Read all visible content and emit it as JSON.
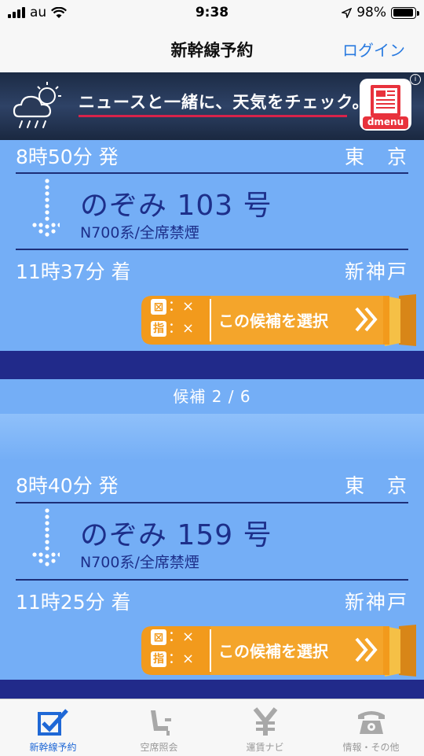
{
  "status_bar": {
    "carrier": "au",
    "time": "9:38",
    "battery": "98%",
    "battery_level": 0.98
  },
  "nav": {
    "title": "新幹線予約",
    "login": "ログイン"
  },
  "ad": {
    "text": "ニュースと一緒に、天気をチェック。",
    "brand": "dmenu",
    "info": "i"
  },
  "trains": [
    {
      "dep_time": "8時50分 発",
      "dep_station": "東　京",
      "name": "のぞみ 103 号",
      "type": "N700系/全席禁煙",
      "arr_time": "11時37分 着",
      "arr_station": "新神戸",
      "mark1": "⊠",
      "mark1_val": "：×",
      "mark2": "指",
      "mark2_val": "：×",
      "select": "この候補を選択"
    },
    {
      "dep_time": "8時40分 発",
      "dep_station": "東　京",
      "name": "のぞみ 159 号",
      "type": "N700系/全席禁煙",
      "arr_time": "11時25分 着",
      "arr_station": "新神戸",
      "mark1": "⊠",
      "mark1_val": "：×",
      "mark2": "指",
      "mark2_val": "：×",
      "select": "この候補を選択"
    }
  ],
  "candidate": "候補 2 / 6",
  "tabs": [
    {
      "label": "新幹線予約",
      "icon": "checkbox-icon"
    },
    {
      "label": "空席照会",
      "icon": "seat-icon"
    },
    {
      "label": "運賃ナビ",
      "icon": "yen-icon"
    },
    {
      "label": "情報・その他",
      "icon": "telephone-icon"
    }
  ],
  "colors": {
    "card": "#74aef6",
    "band": "#212a8a",
    "accent": "#1f68d6",
    "orange": "#f29a1c"
  }
}
